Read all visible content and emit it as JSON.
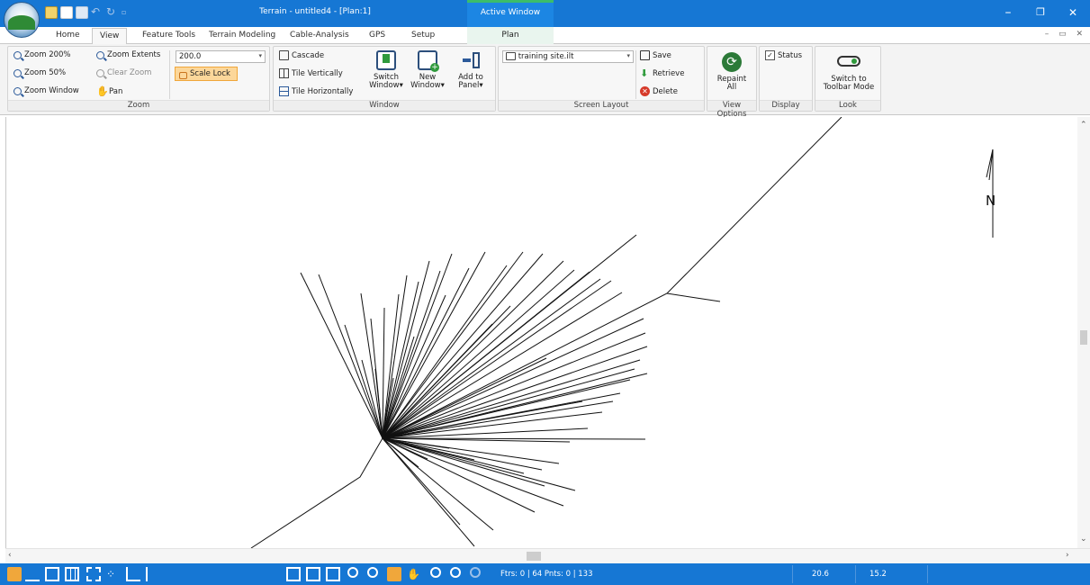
{
  "titlebar": {
    "title": "Terrain - untitled4 - [Plan:1]",
    "context_group": "Active Window",
    "minimize": "–",
    "restore": "❐",
    "close": "✕"
  },
  "tabs": [
    "Home",
    "View",
    "Feature Tools",
    "Terrain Modeling",
    "Cable-Analysis",
    "GPS",
    "Setup"
  ],
  "active_tab": "View",
  "context_tab": "Plan",
  "mdi_controls": "– ▭ ✕",
  "ribbon": {
    "zoom": {
      "label": "Zoom",
      "zoom200": "Zoom 200%",
      "zoom50": "Zoom 50%",
      "zoom_window": "Zoom Window",
      "zoom_extents": "Zoom Extents",
      "clear_zoom": "Clear Zoom",
      "pan": "Pan",
      "scale_value": "200.0",
      "scale_lock": "Scale Lock"
    },
    "window": {
      "label": "Window",
      "cascade": "Cascade",
      "tile_vertically": "Tile Vertically",
      "tile_horizontally": "Tile Horizontally",
      "switch_window_1": "Switch",
      "switch_window_2": "Window",
      "new_window_1": "New",
      "new_window_2": "Window",
      "add_to_panel_1": "Add to",
      "add_to_panel_2": "Panel"
    },
    "screen_layout": {
      "label": "Screen Layout",
      "layout_file": "training site.ilt",
      "save": "Save",
      "retrieve": "Retrieve",
      "delete": "Delete"
    },
    "view_options": {
      "label": "View Options",
      "repaint_1": "Repaint",
      "repaint_2": "All"
    },
    "display": {
      "label": "Display",
      "status": "Status",
      "status_checked": true
    },
    "look": {
      "label": "Look",
      "switch_1": "Switch to",
      "switch_2": "Toolbar Mode"
    }
  },
  "canvas": {
    "north_label": "N"
  },
  "statusbar": {
    "counts": "Ftrs: 0 | 64  Pnts: 0 | 133",
    "x_coord": "20.6",
    "y_coord": "15.2"
  },
  "colors": {
    "title_blue": "#1677d4",
    "context_green": "#3cbd6a",
    "scale_lock_bg": "#fcd79a",
    "status_highlight": "#f0a73b"
  }
}
